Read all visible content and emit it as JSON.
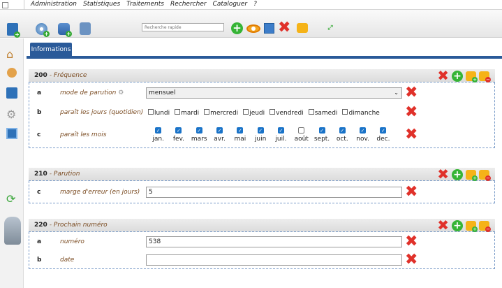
{
  "menu": {
    "items": [
      "Administration",
      "Statistiques",
      "Traitements",
      "Rechercher",
      "Cataloguer",
      "?"
    ]
  },
  "toolbar": {
    "search_placeholder": "Recherche rapide"
  },
  "tab": {
    "label": "Informations"
  },
  "sections": [
    {
      "code": "200",
      "title": "- Fréquence",
      "rows": [
        {
          "letter": "a",
          "label": "mode de parution",
          "value": "mensuel"
        },
        {
          "letter": "b",
          "label": "paraît les jours (quotidien)",
          "days": [
            "lundi",
            "mardi",
            "mercredi",
            "jeudi",
            "vendredi",
            "samedi",
            "dimanche"
          ]
        },
        {
          "letter": "c",
          "label": "paraît les mois",
          "months": [
            {
              "name": "jan.",
              "checked": true
            },
            {
              "name": "fev.",
              "checked": true
            },
            {
              "name": "mars",
              "checked": true
            },
            {
              "name": "avr.",
              "checked": true
            },
            {
              "name": "mai",
              "checked": true
            },
            {
              "name": "juin",
              "checked": true
            },
            {
              "name": "juil.",
              "checked": true
            },
            {
              "name": "août",
              "checked": false
            },
            {
              "name": "sept.",
              "checked": true
            },
            {
              "name": "oct.",
              "checked": true
            },
            {
              "name": "nov.",
              "checked": true
            },
            {
              "name": "dec.",
              "checked": true
            }
          ]
        }
      ]
    },
    {
      "code": "210",
      "title": "- Parution",
      "rows": [
        {
          "letter": "c",
          "label": "marge d'erreur (en jours)",
          "value": "5"
        }
      ]
    },
    {
      "code": "220",
      "title": "- Prochain numéro",
      "rows": [
        {
          "letter": "a",
          "label": "numéro",
          "value": "538"
        },
        {
          "letter": "b",
          "label": "date",
          "value": ""
        }
      ]
    }
  ],
  "colors": {
    "accent": "#2a5a99",
    "delete": "#e0312a",
    "add": "#36b436",
    "label": "#7a4b21"
  }
}
